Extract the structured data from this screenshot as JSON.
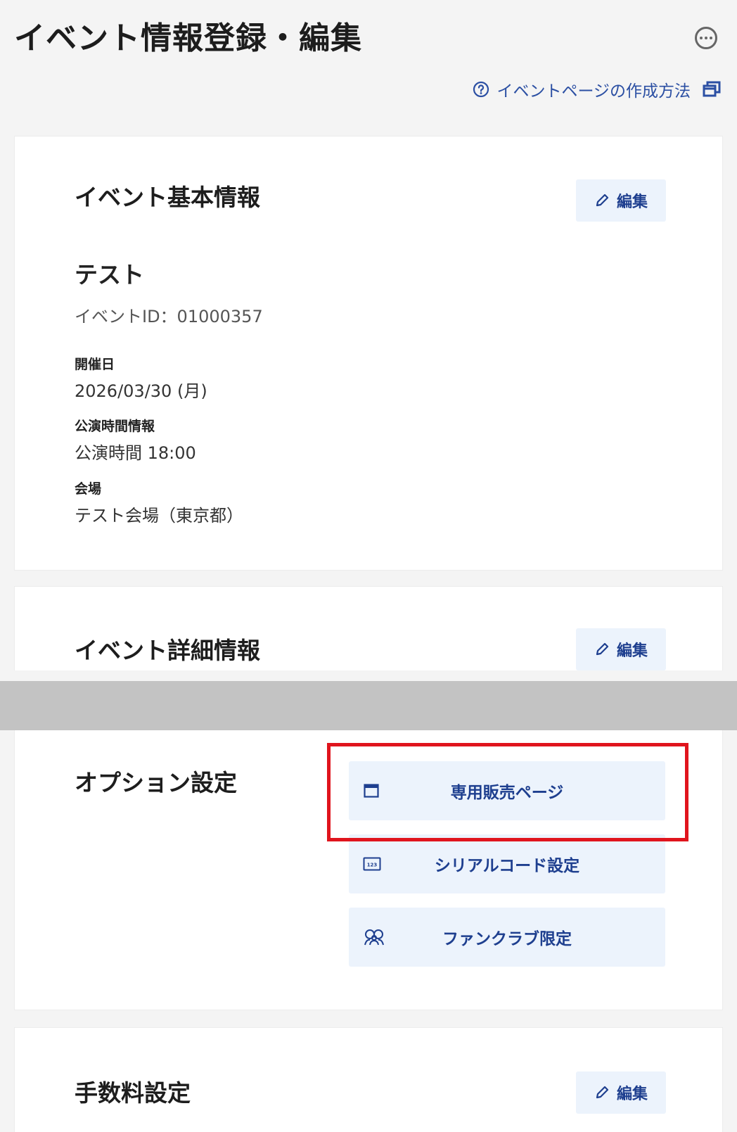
{
  "header": {
    "title": "イベント情報登録・編集",
    "help_link": "イベントページの作成方法"
  },
  "basic_info": {
    "title": "イベント基本情報",
    "edit_label": "編集",
    "event_name": "テスト",
    "event_id": "イベントID：01000357",
    "date_label": "開催日",
    "date_value": "2026/03/30 (月)",
    "time_label": "公演時間情報",
    "time_value": "公演時間 18:00",
    "venue_label": "会場",
    "venue_value": "テスト会場（東京都）"
  },
  "detail_info": {
    "title": "イベント詳細情報",
    "edit_label": "編集"
  },
  "options": {
    "title": "オプション設定",
    "buttons": [
      {
        "label": "専用販売ページ",
        "icon": "window-icon"
      },
      {
        "label": "シリアルコード設定",
        "icon": "serial-code-icon"
      },
      {
        "label": "ファンクラブ限定",
        "icon": "fanclub-icon"
      }
    ]
  },
  "fee": {
    "title": "手数料設定",
    "edit_label": "編集"
  },
  "colors": {
    "accent": "#1e3f8f",
    "button_bg": "#ecf3fc",
    "highlight": "#e0141d",
    "background": "#f4f4f4"
  }
}
